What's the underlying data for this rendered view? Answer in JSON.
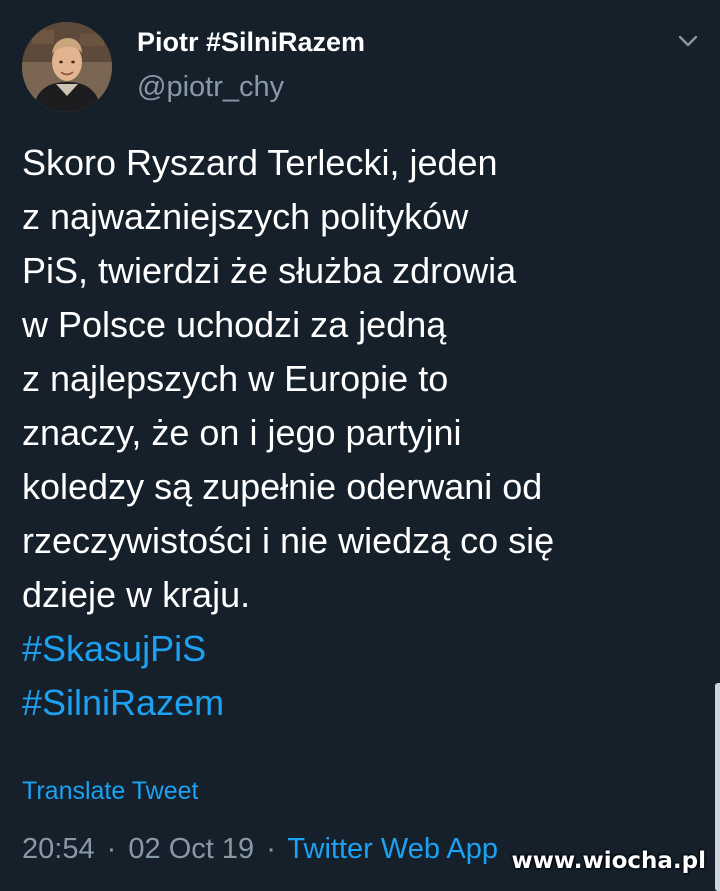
{
  "author": {
    "name": "Piotr #SilniRazem",
    "handle": "@piotr_chy",
    "avatar_icon": "user-avatar-photo"
  },
  "header": {
    "menu_icon": "chevron-down-icon"
  },
  "tweet": {
    "lines": [
      "Skoro Ryszard Terlecki, jeden",
      "z najważniejszych polityków",
      "PiS, twierdzi że służba zdrowia",
      "w Polsce uchodzi za jedną",
      "z najlepszych w Europie to",
      "znaczy, że on i jego partyjni",
      "koledzy są zupełnie oderwani od",
      "rzeczywistości i nie wiedzą co się",
      "dzieje w kraju."
    ],
    "hashtags": [
      "#SkasujPiS",
      "#SilniRazem"
    ],
    "translate_label": "Translate Tweet"
  },
  "meta": {
    "time": "20:54",
    "separator": "·",
    "date": "02 Oct 19",
    "source": "Twitter Web App"
  },
  "watermark": "www.wiocha.pl",
  "colors": {
    "background": "#15202b",
    "text": "#ffffff",
    "secondary_text": "#8899a6",
    "link": "#1da1f2"
  }
}
